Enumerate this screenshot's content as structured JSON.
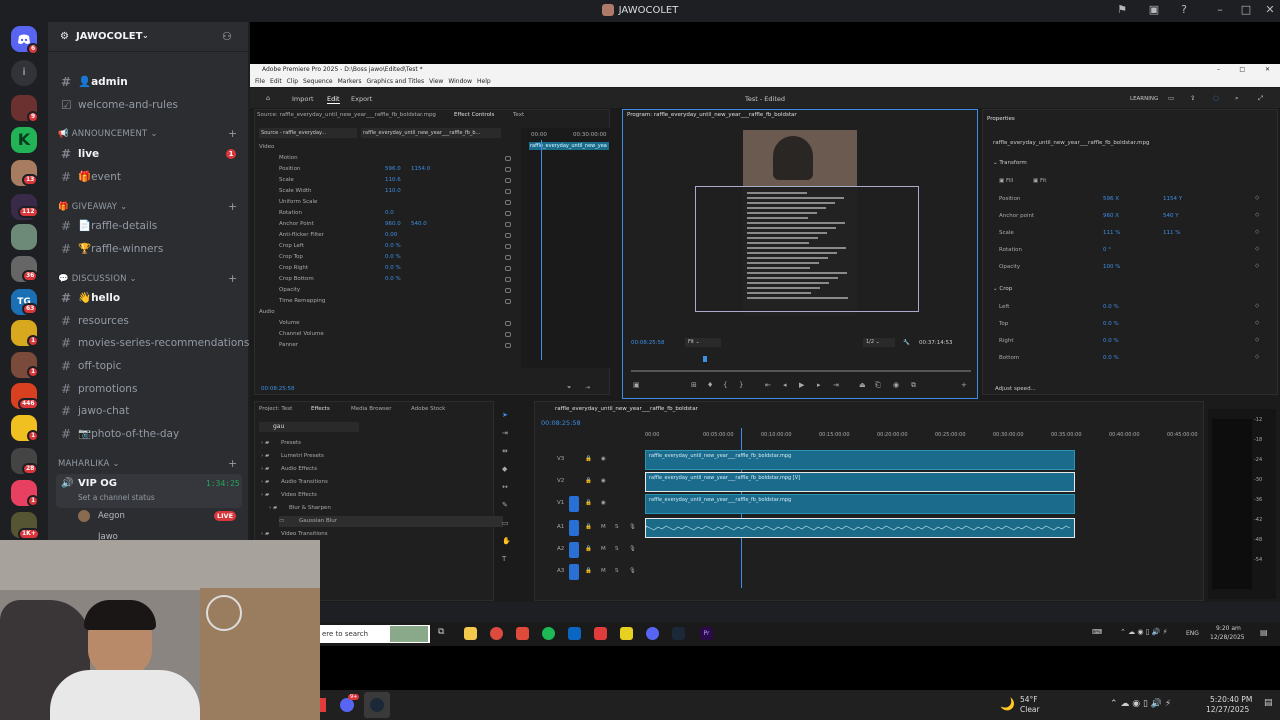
{
  "window": {
    "title": "JAWOCOLET"
  },
  "servers": [
    {
      "badge": "6"
    },
    {
      "badge": ""
    },
    {
      "badge": "9"
    },
    {
      "badge": ""
    },
    {
      "badge": "13"
    },
    {
      "badge": "112"
    },
    {
      "badge": ""
    },
    {
      "badge": "36"
    },
    {
      "badge": "63"
    },
    {
      "badge": "1"
    },
    {
      "badge": "1"
    },
    {
      "badge": "446"
    },
    {
      "badge": "1"
    },
    {
      "badge": "28"
    },
    {
      "badge": "1"
    },
    {
      "badge": "1K+"
    }
  ],
  "guild": {
    "name": "JAWOCOLET"
  },
  "channels": [
    {
      "name": "👤admin",
      "unread": true
    },
    {
      "name": "welcome-and-rules",
      "unread": false,
      "rules": true
    }
  ],
  "categories": {
    "announcement": "ANNOUNCEMENT",
    "giveaway": "GIVEAWAY",
    "discussion": "DISCUSSION",
    "maharlika": "MAHARLIKA"
  },
  "announce_channels": [
    {
      "name": "live",
      "unread": true,
      "badge": "1"
    },
    {
      "name": "🎁event",
      "unread": false
    }
  ],
  "giveaway_channels": [
    {
      "name": "📄raffle-details"
    },
    {
      "name": "🏆raffle-winners"
    }
  ],
  "discussion_channels": [
    {
      "name": "👋hello",
      "unread": true
    },
    {
      "name": "resources"
    },
    {
      "name": "movies-series-recommendations"
    },
    {
      "name": "off-topic"
    },
    {
      "name": "promotions"
    },
    {
      "name": "jawo-chat"
    },
    {
      "name": "📷photo-of-the-day"
    }
  ],
  "voice": {
    "channel": "VIP OG",
    "status": "Set a channel status",
    "timer": "1:34:25",
    "users": [
      {
        "name": "Aegon",
        "live": "LIVE"
      },
      {
        "name": "Jawo"
      }
    ]
  },
  "premiere": {
    "title": "Adobe Premiere Pro 2025 - D:\\Boss jawo\\Edited\\Test *",
    "menu": [
      "File",
      "Edit",
      "Clip",
      "Sequence",
      "Markers",
      "Graphics and Titles",
      "View",
      "Window",
      "Help"
    ],
    "nav": [
      "Import",
      "Edit",
      "Export"
    ],
    "project_state": "Test - Edited",
    "learning": "LEARNING",
    "ec_tabs": [
      "Source: raffle_everyday_until_new_year___raffle_fb_boldstar.mpg",
      "Effect Controls",
      "Text"
    ],
    "ec_source": "Source - raffle_everyday...",
    "ec_clip": "raffle_everyday_until_new_year___raffle_fb_b...",
    "ec_params": [
      {
        "label": "Video"
      },
      {
        "label": "Motion"
      },
      {
        "label": "Position",
        "v1": "596.0",
        "v2": "1154.0"
      },
      {
        "label": "Scale",
        "v1": "110.6"
      },
      {
        "label": "Scale Width",
        "v1": "110.0"
      },
      {
        "label": "Uniform Scale"
      },
      {
        "label": "Rotation",
        "v1": "0.0"
      },
      {
        "label": "Anchor Point",
        "v1": "960.0",
        "v2": "540.0"
      },
      {
        "label": "Anti-flicker Filter",
        "v1": "0.00"
      },
      {
        "label": "Crop Left",
        "v1": "0.0 %"
      },
      {
        "label": "Crop Top",
        "v1": "0.0 %"
      },
      {
        "label": "Crop Right",
        "v1": "0.0 %"
      },
      {
        "label": "Crop Bottom",
        "v1": "0.0 %"
      },
      {
        "label": "Opacity"
      },
      {
        "label": "Time Remapping"
      },
      {
        "label": "Audio"
      },
      {
        "label": "Volume"
      },
      {
        "label": "Channel Volume"
      },
      {
        "label": "Panner"
      }
    ],
    "ec_time": "00:08:25:58",
    "ec_ruler": [
      "00:00",
      "00:30:00:00"
    ],
    "ec_clipbar": "raffle_everyday_until_new_yea",
    "program_tab": "Program: raffle_everyday_until_new_year___raffle_fb_boldstar",
    "program_time": "00:08:25:58",
    "program_fit": "Fit",
    "program_res": "1/2",
    "program_dur": "00:37:14:53",
    "props": {
      "tab": "Properties",
      "clip": "raffle_everyday_until_new_year___raffle_fb_boldstar.mpg",
      "transform": "Transform",
      "fill": "Fill",
      "fit": "Fit",
      "rows": [
        {
          "l": "Position",
          "a": "596 X",
          "b": "1154 Y"
        },
        {
          "l": "Anchor point",
          "a": "960 X",
          "b": "540 Y"
        },
        {
          "l": "Scale",
          "a": "111 %",
          "b": "111 %"
        },
        {
          "l": "Rotation",
          "a": "0 °"
        },
        {
          "l": "Opacity",
          "a": "100 %"
        }
      ],
      "crop": "Crop",
      "crop_rows": [
        {
          "l": "Left",
          "a": "0.0 %"
        },
        {
          "l": "Top",
          "a": "0.0 %"
        },
        {
          "l": "Right",
          "a": "0.0 %"
        },
        {
          "l": "Bottom",
          "a": "0.0 %"
        }
      ],
      "adjust": "Adjust speed..."
    },
    "proj_tabs": [
      "Project: Test",
      "Effects",
      "Media Browser",
      "Adobe Stock"
    ],
    "search": "gau",
    "effects_tree": [
      "Presets",
      "Lumetri Presets",
      "Audio Effects",
      "Audio Transitions",
      "Video Effects",
      "Blur & Sharpen",
      "Gaussian Blur",
      "Video Transitions"
    ],
    "timeline": {
      "tab": "raffle_everyday_until_new_year___raffle_fb_boldstar",
      "time": "00:08:25:58",
      "ruler": [
        "00:00",
        "00:05:00:00",
        "00:10:00:00",
        "00:15:00:00",
        "00:20:00:00",
        "00:25:00:00",
        "00:30:00:00",
        "00:35:00:00",
        "00:40:00:00",
        "00:45:00:00"
      ],
      "tracks": [
        "V3",
        "V2",
        "V1",
        "A1",
        "A2",
        "A3"
      ],
      "clips": [
        {
          "name": "raffle_everyday_until_new_year___raffle_fb_boldstar.mpg"
        },
        {
          "name": "raffle_everyday_until_new_year___raffle_fb_boldstar.mpg [V]"
        },
        {
          "name": "raffle_everyday_until_new_year___raffle_fb_boldstar.mpg"
        }
      ]
    },
    "meter_ticks": [
      "-12",
      "-18",
      "-24",
      "-30",
      "-36",
      "-42",
      "-48",
      "-54"
    ]
  },
  "taskbar": {
    "search": "ere to search",
    "lang": "ENG",
    "time": "9:20 am",
    "date": "12/28/2025"
  },
  "taskbar2": {
    "temp": "54°F",
    "weather": "Clear",
    "time": "5:20:40 PM",
    "date": "12/27/2025",
    "badge": "9+"
  }
}
